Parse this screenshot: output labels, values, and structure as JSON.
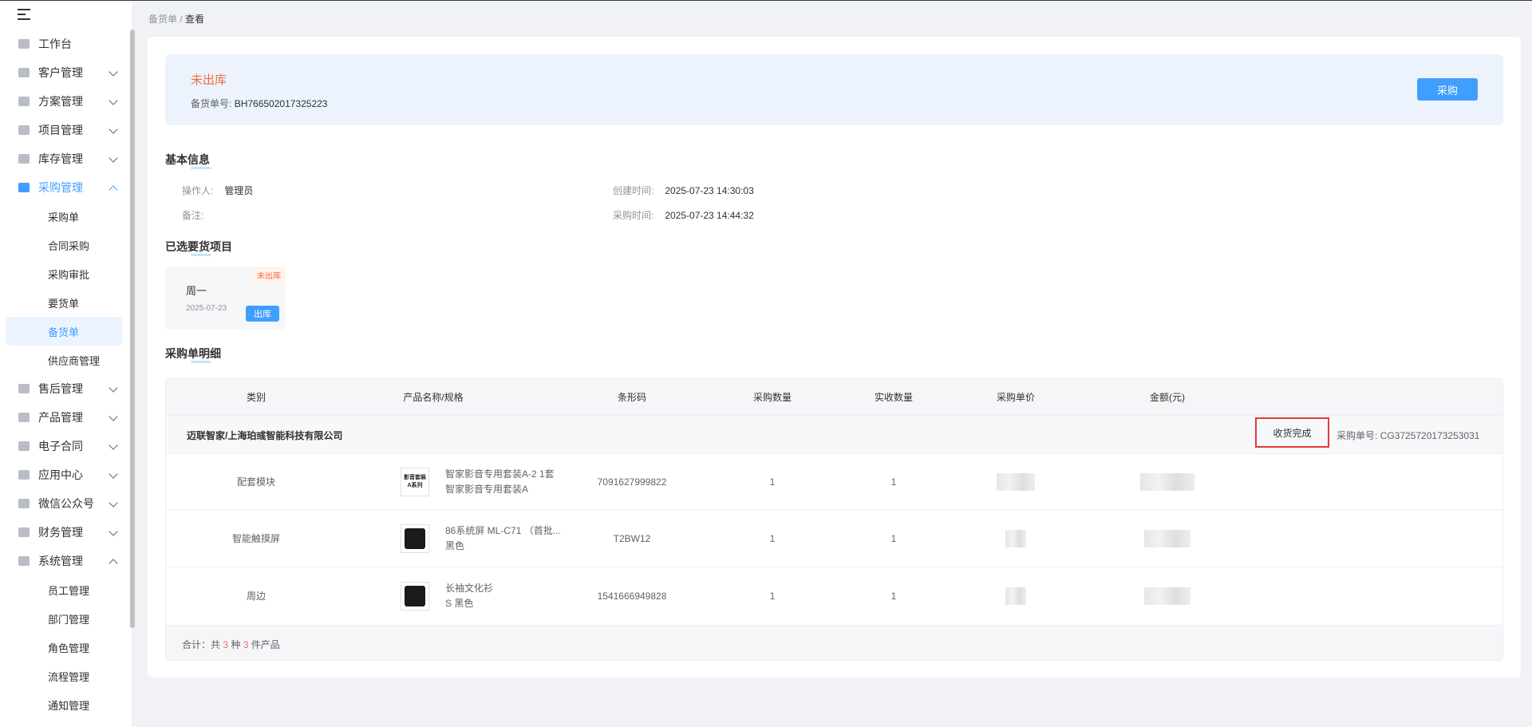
{
  "breadcrumb": {
    "parent": "备货单",
    "sep": "/",
    "current": "查看"
  },
  "sidebar": {
    "items": [
      {
        "label": "工作台",
        "icon": "home-icon",
        "chevron": ""
      },
      {
        "label": "客户管理",
        "icon": "customer-icon",
        "chevron": "down"
      },
      {
        "label": "方案管理",
        "icon": "plan-icon",
        "chevron": "down"
      },
      {
        "label": "项目管理",
        "icon": "folder-icon",
        "chevron": "down"
      },
      {
        "label": "库存管理",
        "icon": "stock-icon",
        "chevron": "down"
      },
      {
        "label": "采购管理",
        "icon": "cart-icon",
        "chevron": "up",
        "active": true,
        "children": [
          "采购单",
          "合同采购",
          "采购审批",
          "要货单",
          "备货单",
          "供应商管理"
        ],
        "active_child": "备货单"
      },
      {
        "label": "售后管理",
        "icon": "headset-icon",
        "chevron": "down"
      },
      {
        "label": "产品管理",
        "icon": "product-icon",
        "chevron": "down"
      },
      {
        "label": "电子合同",
        "icon": "contract-icon",
        "chevron": "down"
      },
      {
        "label": "应用中心",
        "icon": "apps-icon",
        "chevron": "down"
      },
      {
        "label": "微信公众号",
        "icon": "wechat-icon",
        "chevron": "down"
      },
      {
        "label": "财务管理",
        "icon": "finance-icon",
        "chevron": "down"
      },
      {
        "label": "系统管理",
        "icon": "settings-icon",
        "chevron": "up",
        "children": [
          "员工管理",
          "部门管理",
          "角色管理",
          "流程管理",
          "通知管理"
        ]
      }
    ]
  },
  "status": {
    "label": "未出库",
    "order_label": "备货单号:",
    "order_no": "BH766502017325223",
    "purchase_button": "采购"
  },
  "basic_info": {
    "title": "基本信息",
    "operator_label": "操作人:",
    "operator": "管理员",
    "remark_label": "备注:",
    "remark": "",
    "created_label": "创建时间:",
    "created": "2025-07-23 14:30:03",
    "purchase_time_label": "采购时间:",
    "purchase_time": "2025-07-23 14:44:32"
  },
  "selected": {
    "title": "已选要货项目",
    "card": {
      "name": "周一",
      "date": "2025-07-23",
      "tag": "未出库",
      "button": "出库"
    }
  },
  "detail": {
    "title": "采购单明细",
    "columns": [
      "类别",
      "产品名称/规格",
      "条形码",
      "采购数量",
      "实收数量",
      "采购单价",
      "金额(元)"
    ],
    "supplier": {
      "name": "迈联智家/上海珀彧智能科技有限公司",
      "status": "收货完成",
      "po_label": "采购单号:",
      "po_no": "CG3725720173253031"
    },
    "rows": [
      {
        "category": "配套模块",
        "name_line1": "智家影音专用套装A-2 1套",
        "name_line2": "智家影音专用套装A",
        "barcode": "7091627999822",
        "qty": "1",
        "received": "1",
        "thumb": "影音套装 A系列"
      },
      {
        "category": "智能触摸屏",
        "name_line1": "86系统屏 ML-C71 （首批...",
        "name_line2": "黑色",
        "barcode": "T2BW12",
        "qty": "1",
        "received": "1",
        "thumb": ""
      },
      {
        "category": "周边",
        "name_line1": "长袖文化衫",
        "name_line2": "S 黑色",
        "barcode": "1541666949828",
        "qty": "1",
        "received": "1",
        "thumb": ""
      }
    ],
    "footer": {
      "prefix": "合计：共",
      "kinds": "3",
      "mid": "种",
      "count": "3",
      "suffix": "件产品"
    }
  }
}
